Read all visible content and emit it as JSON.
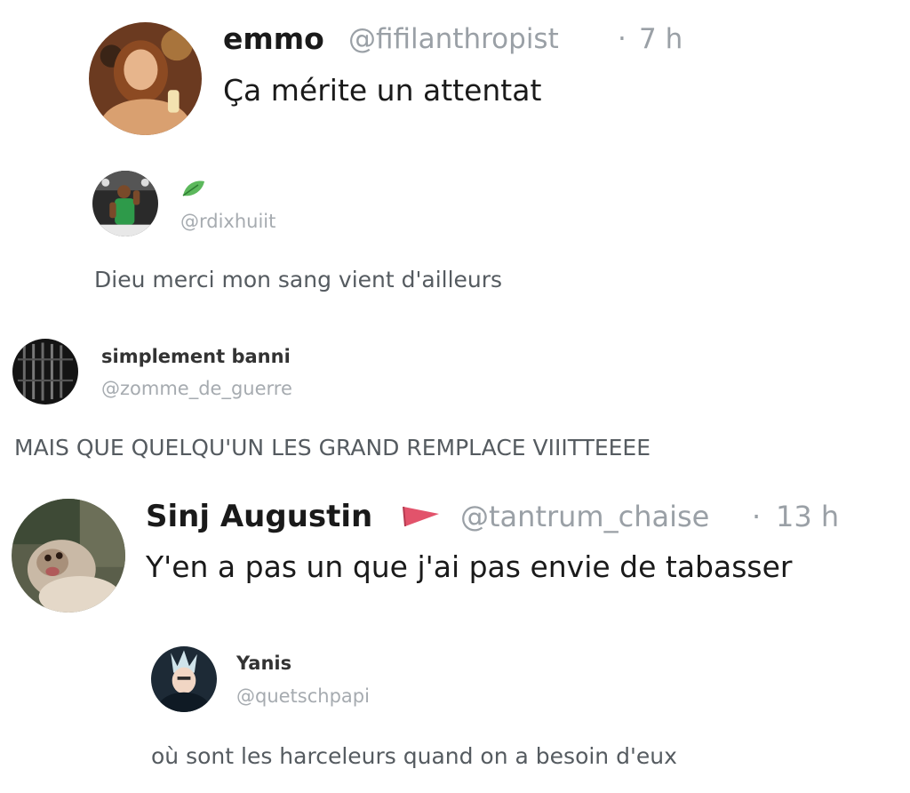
{
  "tweet1": {
    "name": "emmo",
    "handle": "@fifilanthropist",
    "separator": "·",
    "time": "7 h",
    "text": "Ça mérite un attentat"
  },
  "reply1": {
    "badge_icon": "leaf-icon",
    "handle": "@rdixhuiit",
    "text": "Dieu merci mon sang vient d'ailleurs"
  },
  "reply2": {
    "name": "simplement banni",
    "handle": "@zomme_de_guerre",
    "text": "MAIS QUE QUELQU'UN LES GRAND REMPLACE VIIITTEEEE"
  },
  "tweet2": {
    "name": "Sinj Augustin",
    "badge_icon": "red-flag-icon",
    "handle": "@tantrum_chaise",
    "separator": "·",
    "time": "13 h",
    "text": "Y'en a pas un que j'ai pas envie de tabasser"
  },
  "reply3": {
    "name": "Yanis",
    "handle": "@quetschpapi",
    "text": "où sont les harceleurs quand on a besoin d'eux"
  },
  "colors": {
    "name": "#1a1a1a",
    "handle": "#9aa0a6",
    "reply_text": "#555b60",
    "flag": "#e2536b",
    "leaf": "#5cb85c"
  }
}
